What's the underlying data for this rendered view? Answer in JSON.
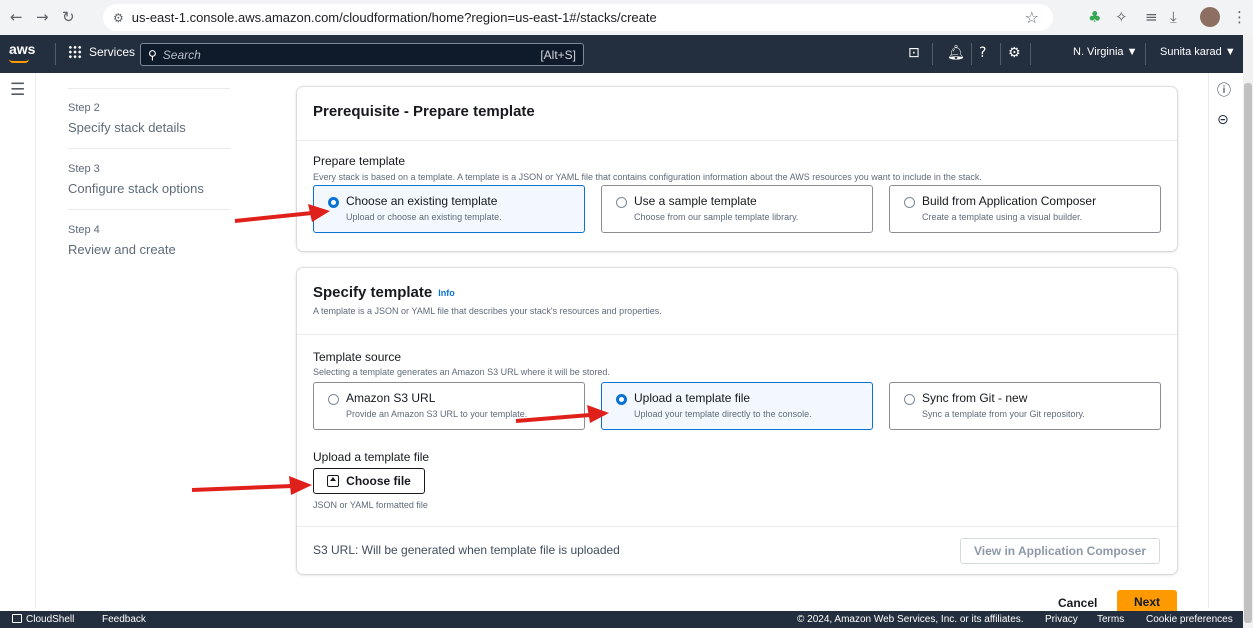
{
  "browser": {
    "url": "us-east-1.console.aws.amazon.com/cloudformation/home?region=us-east-1#/stacks/create"
  },
  "nav": {
    "logo": "aws",
    "services": "Services",
    "search_placeholder": "Search",
    "search_shortcut": "[Alt+S]",
    "region": "N. Virginia ▼",
    "user": "Sunita karad ▼"
  },
  "steps": [
    {
      "num": "Step 2",
      "label": "Specify stack details"
    },
    {
      "num": "Step 3",
      "label": "Configure stack options"
    },
    {
      "num": "Step 4",
      "label": "Review and create"
    }
  ],
  "prereq": {
    "title": "Prerequisite - Prepare template",
    "field_label": "Prepare template",
    "field_desc": "Every stack is based on a template. A template is a JSON or YAML file that contains configuration information about the AWS resources you want to include in the stack.",
    "options": [
      {
        "title": "Choose an existing template",
        "desc": "Upload or choose an existing template.",
        "selected": true
      },
      {
        "title": "Use a sample template",
        "desc": "Choose from our sample template library.",
        "selected": false
      },
      {
        "title": "Build from Application Composer",
        "desc": "Create a template using a visual builder.",
        "selected": false
      }
    ]
  },
  "specify": {
    "title": "Specify template",
    "info": "Info",
    "subtitle": "A template is a JSON or YAML file that describes your stack's resources and properties.",
    "source_label": "Template source",
    "source_desc": "Selecting a template generates an Amazon S3 URL where it will be stored.",
    "options": [
      {
        "title": "Amazon S3 URL",
        "desc": "Provide an Amazon S3 URL to your template.",
        "selected": false
      },
      {
        "title": "Upload a template file",
        "desc": "Upload your template directly to the console.",
        "selected": true
      },
      {
        "title": "Sync from Git - new",
        "desc": "Sync a template from your Git repository.",
        "selected": false
      }
    ],
    "upload_label": "Upload a template file",
    "choose_file": "Choose file",
    "upload_hint": "JSON or YAML formatted file",
    "s3_url": "S3 URL:  Will be generated when template file is uploaded",
    "view_composer": "View in Application Composer"
  },
  "actions": {
    "cancel": "Cancel",
    "next": "Next"
  },
  "footer": {
    "cloudshell": "CloudShell",
    "feedback": "Feedback",
    "copyright": "© 2024, Amazon Web Services, Inc. or its affiliates.",
    "privacy": "Privacy",
    "terms": "Terms",
    "cookies": "Cookie preferences"
  },
  "colors": {
    "accent": "#0972d3",
    "nav_bg": "#232f3e",
    "primary_button": "#ff9900",
    "annotation_arrow": "#e0211b"
  }
}
